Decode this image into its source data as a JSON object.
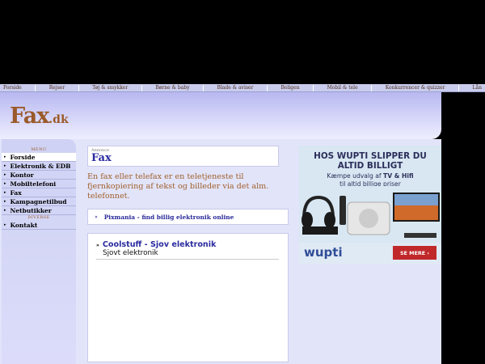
{
  "topnav": [
    "Forside",
    "Rejser",
    "Tøj & smykker",
    "Børne & baby",
    "Blade & aviser",
    "Boligen",
    "Mobil & tele",
    "Konkurrencer & quizzer",
    "Lån"
  ],
  "logo": {
    "main": "Fax",
    "suffix": ".dk"
  },
  "sidebar": {
    "menu_label": "MENU",
    "items": [
      "Forside",
      "Elektronik & EDB",
      "Kontor",
      "Mobiltelefoni",
      "Fax",
      "Kampagnetilbud",
      "Netbutikker"
    ],
    "misc_label": "DIVERSE",
    "misc_items": [
      "Kontakt"
    ]
  },
  "main": {
    "ad_label": "Annonce",
    "title": "Fax",
    "description": "En fax eller telefax er en teletjeneste til fjernkopiering af tekst og billeder via det alm. telefonnet.",
    "pixmania_link": "Pixmania - find billig elektronik online",
    "entries": [
      {
        "title": "Coolstuff - Sjov elektronik",
        "subtitle": "Sjovt elektronik"
      }
    ]
  },
  "banner": {
    "headline_1": "HOS WUPTI SLIPPER DU",
    "headline_2": "ALTID BILLIGT",
    "sub_1_pre": "Kæmpe udvalg  af ",
    "sub_1_bold": "TV & Hifi",
    "sub_2": "til altid billige priser",
    "logo": "wupti",
    "button": "SE MERE ›"
  },
  "colors": {
    "accent": "#2a2aa0",
    "brand": "#9a5a2a",
    "cta": "#c0282a"
  }
}
